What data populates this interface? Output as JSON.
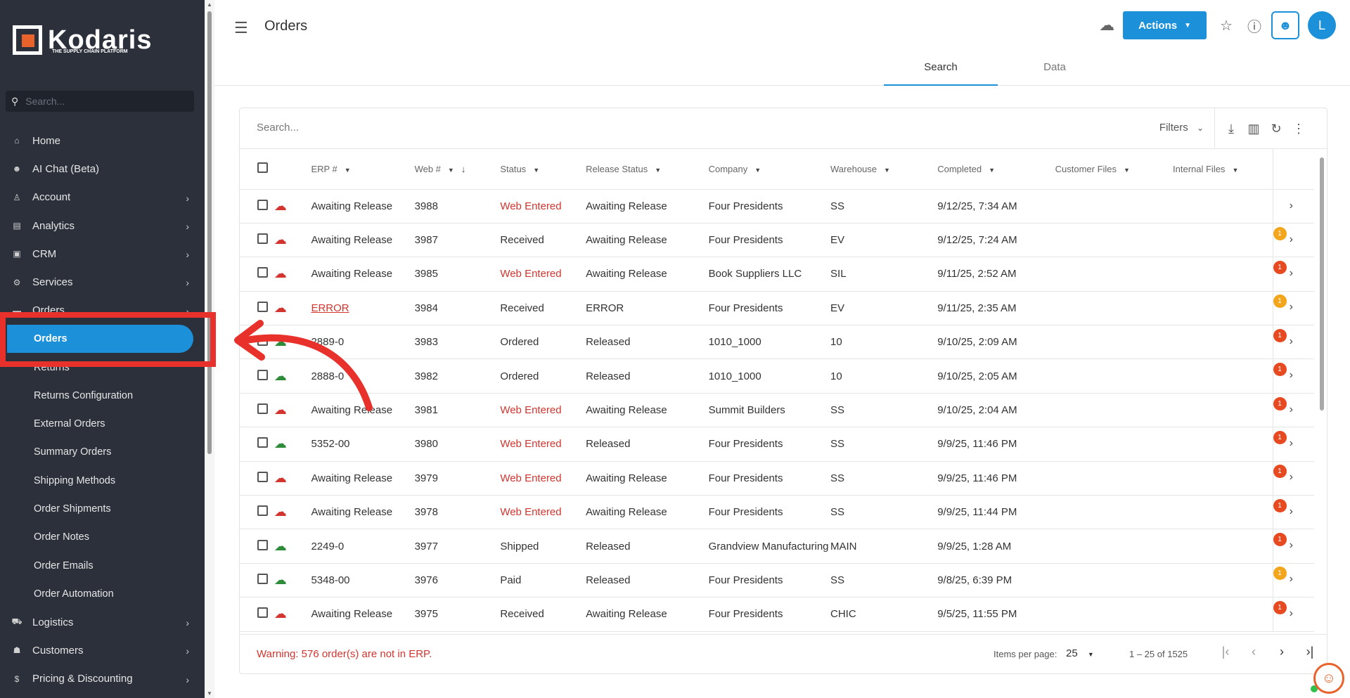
{
  "brand": {
    "name": "Kodaris",
    "tagline": "THE SUPPLY CHAIN PLATFORM",
    "accent": "#1c90d8",
    "logo_color": "#e8632b"
  },
  "sidebar": {
    "search_placeholder": "Search...",
    "items": [
      {
        "label": "Home",
        "icon": "home-icon",
        "glyph": "⌂",
        "chevron": false
      },
      {
        "label": "AI Chat (Beta)",
        "icon": "robot-icon",
        "glyph": "☻",
        "chevron": false
      },
      {
        "label": "Account",
        "icon": "person-icon",
        "glyph": "♙",
        "chevron": true
      },
      {
        "label": "Analytics",
        "icon": "chart-icon",
        "glyph": "▤",
        "chevron": true
      },
      {
        "label": "CRM",
        "icon": "crm-icon",
        "glyph": "▣",
        "chevron": true
      },
      {
        "label": "Services",
        "icon": "services-icon",
        "glyph": "⚙",
        "chevron": true
      },
      {
        "label": "Orders",
        "icon": "cart-icon",
        "glyph": "▬",
        "chevron": true
      }
    ],
    "sub_items": [
      {
        "label": "Orders",
        "active": true
      },
      {
        "label": "Returns",
        "active": false
      },
      {
        "label": "Returns Configuration",
        "active": false
      },
      {
        "label": "External Orders",
        "active": false
      },
      {
        "label": "Summary Orders",
        "active": false
      },
      {
        "label": "Shipping Methods",
        "active": false
      },
      {
        "label": "Order Shipments",
        "active": false
      },
      {
        "label": "Order Notes",
        "active": false
      },
      {
        "label": "Order Emails",
        "active": false
      },
      {
        "label": "Order Automation",
        "active": false
      }
    ],
    "bottom_items": [
      {
        "label": "Logistics",
        "icon": "truck-icon",
        "glyph": "⛟",
        "chevron": true
      },
      {
        "label": "Customers",
        "icon": "people-icon",
        "glyph": "☗",
        "chevron": true
      },
      {
        "label": "Pricing & Discounting",
        "icon": "dollar-icon",
        "glyph": "$",
        "chevron": true
      }
    ]
  },
  "header": {
    "title": "Orders",
    "actions_label": "Actions",
    "avatar_initial": "L",
    "tabs": [
      {
        "label": "Search",
        "active": true
      },
      {
        "label": "Data",
        "active": false
      }
    ]
  },
  "table": {
    "search_placeholder": "Search...",
    "filters_label": "Filters",
    "columns": [
      "ERP #",
      "Web #",
      "Status",
      "Release Status",
      "Company",
      "Warehouse",
      "Completed",
      "Customer Files",
      "Internal Files"
    ],
    "rows": [
      {
        "erp": "Awaiting Release",
        "web": "3988",
        "status": "Web Entered",
        "status_red": true,
        "release": "Awaiting Release",
        "company": "Four Presidents",
        "warehouse": "SS",
        "completed": "9/12/25, 7:34 AM",
        "cloud": "red",
        "badge": ""
      },
      {
        "erp": "Awaiting Release",
        "web": "3987",
        "status": "Received",
        "status_red": false,
        "release": "Awaiting Release",
        "company": "Four Presidents",
        "warehouse": "EV",
        "completed": "9/12/25, 7:24 AM",
        "cloud": "red",
        "badge": "orange"
      },
      {
        "erp": "Awaiting Release",
        "web": "3985",
        "status": "Web Entered",
        "status_red": true,
        "release": "Awaiting Release",
        "company": "Book Suppliers LLC",
        "warehouse": "SIL",
        "completed": "9/11/25, 2:52 AM",
        "cloud": "red",
        "badge": "red"
      },
      {
        "erp": "ERROR",
        "erp_error": true,
        "web": "3984",
        "status": "Received",
        "status_red": false,
        "release": "ERROR",
        "company": "Four Presidents",
        "warehouse": "EV",
        "completed": "9/11/25, 2:35 AM",
        "cloud": "red",
        "badge": "orange"
      },
      {
        "erp": "2889-0",
        "web": "3983",
        "status": "Ordered",
        "status_red": false,
        "release": "Released",
        "company": "1010_1000",
        "warehouse": "10",
        "completed": "9/10/25, 2:09 AM",
        "cloud": "green",
        "badge": "red"
      },
      {
        "erp": "2888-0",
        "web": "3982",
        "status": "Ordered",
        "status_red": false,
        "release": "Released",
        "company": "1010_1000",
        "warehouse": "10",
        "completed": "9/10/25, 2:05 AM",
        "cloud": "green",
        "badge": "red"
      },
      {
        "erp": "Awaiting Release",
        "web": "3981",
        "status": "Web Entered",
        "status_red": true,
        "release": "Awaiting Release",
        "company": "Summit Builders",
        "warehouse": "SS",
        "completed": "9/10/25, 2:04 AM",
        "cloud": "red",
        "badge": "red"
      },
      {
        "erp": "5352-00",
        "web": "3980",
        "status": "Web Entered",
        "status_red": true,
        "release": "Released",
        "company": "Four Presidents",
        "warehouse": "SS",
        "completed": "9/9/25, 11:46 PM",
        "cloud": "green",
        "badge": "red"
      },
      {
        "erp": "Awaiting Release",
        "web": "3979",
        "status": "Web Entered",
        "status_red": true,
        "release": "Awaiting Release",
        "company": "Four Presidents",
        "warehouse": "SS",
        "completed": "9/9/25, 11:46 PM",
        "cloud": "red",
        "badge": "red"
      },
      {
        "erp": "Awaiting Release",
        "web": "3978",
        "status": "Web Entered",
        "status_red": true,
        "release": "Awaiting Release",
        "company": "Four Presidents",
        "warehouse": "SS",
        "completed": "9/9/25, 11:44 PM",
        "cloud": "red",
        "badge": "red"
      },
      {
        "erp": "2249-0",
        "web": "3977",
        "status": "Shipped",
        "status_red": false,
        "release": "Released",
        "company": "Grandview Manufacturing",
        "warehouse": "MAIN",
        "completed": "9/9/25, 1:28 AM",
        "cloud": "green",
        "badge": "red"
      },
      {
        "erp": "5348-00",
        "web": "3976",
        "status": "Paid",
        "status_red": false,
        "release": "Released",
        "company": "Four Presidents",
        "warehouse": "SS",
        "completed": "9/8/25, 6:39 PM",
        "cloud": "green",
        "badge": "orange"
      },
      {
        "erp": "Awaiting Release",
        "web": "3975",
        "status": "Received",
        "status_red": false,
        "release": "Awaiting Release",
        "company": "Four Presidents",
        "warehouse": "CHIC",
        "completed": "9/5/25, 11:55 PM",
        "cloud": "red",
        "badge": "red"
      }
    ],
    "badge_count": "1"
  },
  "footer": {
    "warning": "Warning: 576 order(s) are not in ERP.",
    "items_per_page_label": "Items per page:",
    "items_per_page": "25",
    "range": "1 – 25 of 1525"
  }
}
